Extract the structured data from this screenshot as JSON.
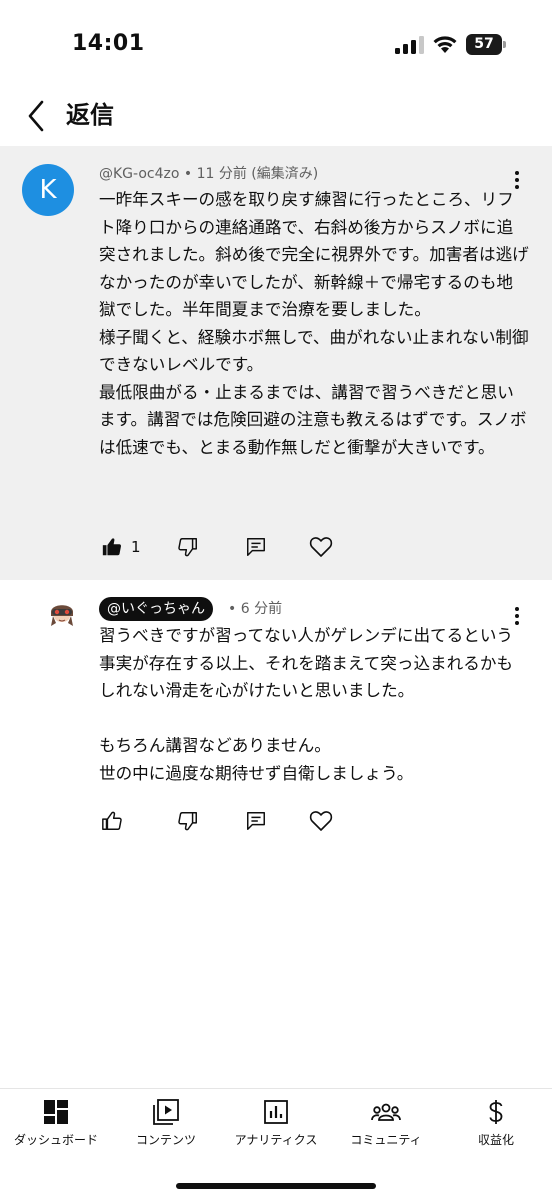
{
  "status_bar": {
    "time": "14:01",
    "battery": "57",
    "icons": [
      "cellular-signal-icon",
      "wifi-icon",
      "battery-icon"
    ]
  },
  "header": {
    "back_icon": "chevron-left-icon",
    "title": "返信"
  },
  "parent_comment": {
    "avatar_letter": "K",
    "avatar_color": "#1e8fe1",
    "meta": "@KG-oc4zo • 11 分前 (編集済み)",
    "text": "一昨年スキーの感を取り戻す練習に行ったところ、リフト降り口からの連絡通路で、右斜め後方からスノボに追突されました。斜め後で完全に視界外です。加害者は逃げなかったのが幸いでしたが、新幹線＋で帰宅するのも地獄でした。半年間夏まで治療を要しました。\n様子聞くと、経験ホボ無しで、曲がれない止まれない制御できないレベルです。\n最低限曲がる・止まるまでは、講習で習うべきだと思います。講習では危険回避の注意も教えるはずです。スノボは低速でも、とまる動作無しだと衝撃が大きいです。",
    "like_count": "1",
    "liked": true,
    "actions": [
      "thumbs-up-icon",
      "thumbs-down-icon",
      "reply-icon",
      "heart-icon"
    ]
  },
  "reply": {
    "handle": "@いぐっちゃん",
    "time": "• 6 分前",
    "text": "習うべきですが習ってない人がゲレンデに出てるという事実が存在する以上、それを踏まえて突っ込まれるかもしれない滑走を心がけたいと思いました。\n\nもちろん講習などありません。\n世の中に過度な期待せず自衛しましょう。",
    "actions": [
      "thumbs-up-icon",
      "thumbs-down-icon",
      "reply-icon",
      "heart-icon"
    ]
  },
  "bottom_nav": {
    "items": [
      {
        "label": "ダッシュボード",
        "icon": "dashboard-icon"
      },
      {
        "label": "コンテンツ",
        "icon": "content-icon"
      },
      {
        "label": "アナリティクス",
        "icon": "analytics-icon"
      },
      {
        "label": "コミュニティ",
        "icon": "community-icon"
      },
      {
        "label": "収益化",
        "icon": "dollar-icon"
      }
    ]
  },
  "colors": {
    "accent": "#1e8fe1",
    "parent_bg": "#f0f0f0",
    "meta_text": "#606060"
  }
}
